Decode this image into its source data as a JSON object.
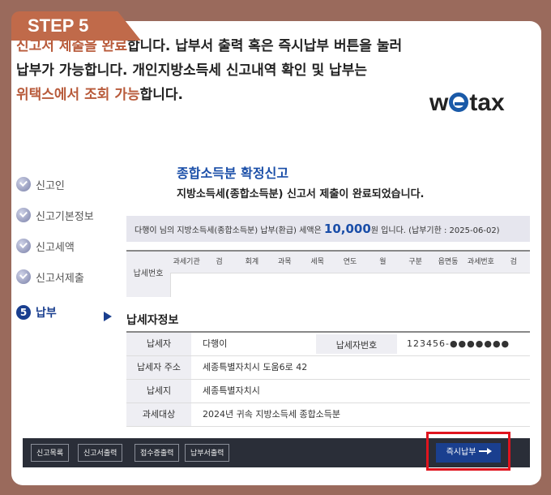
{
  "step_tab": "STEP 5",
  "intro": {
    "l1_hl1": "신고서 제출을 완료",
    "l1_rest": "합니다. 납부서 출력 혹은 즉시납부 버튼을 눌러",
    "l2": "납부가 가능합니다. 개인지방소득세 신고내역 확인 및 납부는",
    "l3_hl": "위택스에서 조회 가능",
    "l3_rest": "합니다."
  },
  "logo": {
    "pre": "w",
    "post": "tax"
  },
  "steps": [
    {
      "label": "신고인"
    },
    {
      "label": "신고기본정보"
    },
    {
      "label": "신고세액"
    },
    {
      "label": "신고서제출"
    }
  ],
  "active_step": {
    "num": "5",
    "label": "납부"
  },
  "main": {
    "title": "종합소득분 확정신고",
    "subtitle": "지방소득세(종합소득분) 신고서 제출이 완료되었습니다."
  },
  "notice": {
    "pre": "다행이 님의 지방소득세(종합소득분) 납부(환급) 세액은 ",
    "amount": "10,000",
    "post": "원 입니다. (납부기한 : 2025-06-02)"
  },
  "payment_grid": {
    "row_label": "납세번호",
    "headers": [
      "과세기관",
      "검",
      "회계",
      "과목",
      "세목",
      "연도",
      "월",
      "구분",
      "읍면동",
      "과세번호",
      "검"
    ]
  },
  "taxpayer": {
    "section_title": "납세자정보",
    "name_label": "납세자",
    "name_value": "다행이",
    "id_label": "납세자번호",
    "id_value": "123456-●●●●●●●",
    "addr_label": "납세자 주소",
    "addr_value": "세종특별자치시 도움6로 42",
    "loc_label": "납세지",
    "loc_value": "세종특별자치시",
    "target_label": "과세대상",
    "target_value": "2024년 귀속 지방소득세 종합소득분"
  },
  "toolbar": {
    "btn1": "신고목록",
    "btn2": "신고서출력",
    "btn3": "접수증출력",
    "btn4": "납부서출력",
    "pay": "즉시납부"
  }
}
